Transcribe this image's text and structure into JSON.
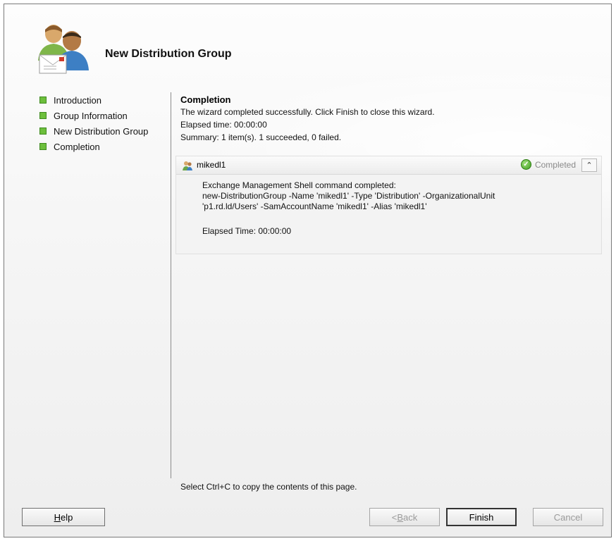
{
  "header": {
    "title": "New Distribution Group",
    "logo_icon": "distribution-group-users-icon"
  },
  "sidebar": {
    "steps": [
      {
        "label": "Introduction",
        "bullet_color": "#6dbf3c"
      },
      {
        "label": "Group Information",
        "bullet_color": "#6dbf3c"
      },
      {
        "label": "New Distribution Group",
        "bullet_color": "#6dbf3c"
      },
      {
        "label": "Completion",
        "bullet_color": "#6dbf3c"
      }
    ]
  },
  "content": {
    "title": "Completion",
    "message": "The wizard completed successfully. Click Finish to close this wizard.",
    "elapsed": "Elapsed time: 00:00:00",
    "summary": "Summary: 1 item(s). 1 succeeded, 0 failed."
  },
  "result_item": {
    "name": "mikedl1",
    "status": "Completed",
    "icon": "user-icon",
    "status_icon": "check-icon",
    "collapse_icon": "chevron-up-double-icon",
    "details": {
      "line1": "Exchange Management Shell command completed:",
      "line2": "new-DistributionGroup -Name 'mikedl1' -Type 'Distribution' -OrganizationalUnit",
      "line3": "'p1.rd.ld/Users' -SamAccountName 'mikedl1' -Alias 'mikedl1'",
      "elapsed": "Elapsed Time: 00:00:00"
    }
  },
  "hint": "Select Ctrl+C to copy the contents of this page.",
  "buttons": {
    "help_prefix": "",
    "help_ul": "H",
    "help_rest": "elp",
    "back_prefix": "< ",
    "back_ul": "B",
    "back_rest": "ack",
    "finish": "Finish",
    "cancel": "Cancel"
  }
}
